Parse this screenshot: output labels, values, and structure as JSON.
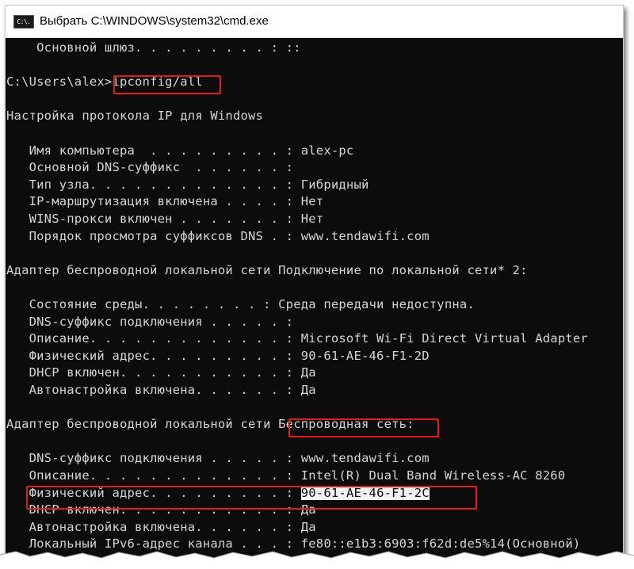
{
  "window": {
    "title": "Выбрать C:\\WINDOWS\\system32\\cmd.exe",
    "icon_label": "C:\\."
  },
  "console": {
    "lines": [
      "    Основной шлюз. . . . . . . . . : ::",
      "",
      "C:\\Users\\alex>ipconfig/all",
      "",
      "Настройка протокола IP для Windows",
      "",
      "   Имя компьютера  . . . . . . . . . : alex-pc",
      "   Основной DNS-суффикс  . . . . . . :",
      "   Тип узла. . . . . . . . . . . . . : Гибридный",
      "   IP-маршрутизация включена . . . . : Нет",
      "   WINS-прокси включен . . . . . . . : Нет",
      "   Порядок просмотра суффиксов DNS . : www.tendawifi.com",
      "",
      "Адаптер беспроводной локальной сети Подключение по локальной сети* 2:",
      "",
      "   Состояние среды. . . . . . . . : Среда передачи недоступна.",
      "   DNS-суффикс подключения . . . . . :",
      "   Описание. . . . . . . . . . . . . : Microsoft Wi-Fi Direct Virtual Adapter",
      "   Физический адрес. . . . . . . . . : 90-61-AE-46-F1-2D",
      "   DHCP включен. . . . . . . . . . . : Да",
      "   Автонастройка включена. . . . . . : Да",
      "",
      "Адаптер беспроводной локальной сети Беспроводная сеть:",
      "",
      "   DNS-суффикс подключения . . . . . : www.tendawifi.com",
      "   Описание. . . . . . . . . . . . . : Intel(R) Dual Band Wireless-AC 8260",
      "   Физический адрес. . . . . . . . . : ",
      "   DHCP включен. . . . . . . . . . . : Да",
      "   Автонастройка включена. . . . . . : Да",
      "   Локальный IPv6-адрес канала . . . : fe80::e1b3:6903:f62d:de5%14(Основной)"
    ],
    "selected_mac": "90-61-AE-46-F1-2C"
  },
  "colors": {
    "console_bg": "#0c0c0c",
    "console_text": "#d4d4d4",
    "highlight": "#e41a1a",
    "selection_bg": "#f2f2f2"
  }
}
